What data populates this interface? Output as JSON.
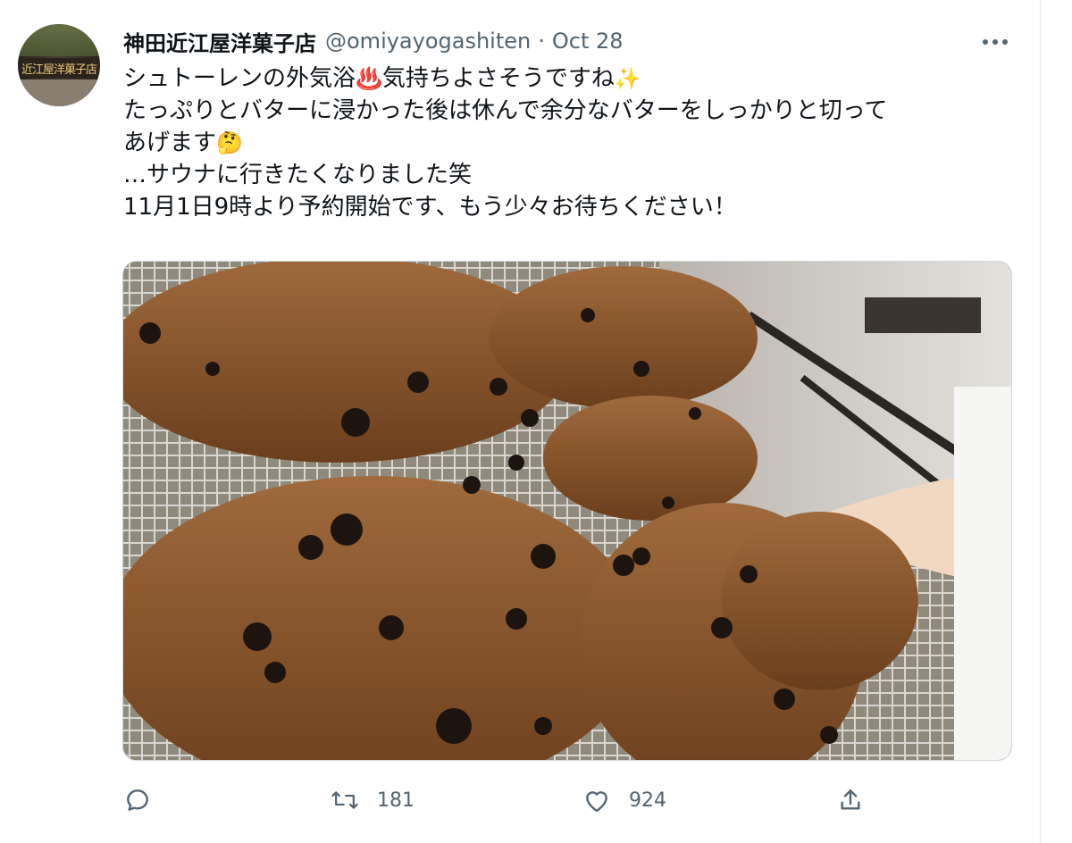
{
  "tweet": {
    "display_name": "神田近江屋洋菓子店",
    "handle": "@omiyayogashiten",
    "separator": "·",
    "date": "Oct 28",
    "avatar_sign_text": "近江屋洋菓子店",
    "lines": [
      {
        "text": "シュトーレンの外気浴",
        "emoji": "♨️",
        "after": "気持ちよさそうですね",
        "emoji2": "✨"
      },
      {
        "text": "たっぷりとバターに浸かった後は休んで余分なバターをしっかりと切って"
      },
      {
        "text": "あげます",
        "emoji": "🤔"
      },
      {
        "text": "…サウナに行きたくなりました笑"
      },
      {
        "text": "11月1日9時より予約開始です、もう少々お待ちください！"
      }
    ]
  },
  "actions": {
    "reply": {
      "icon": "reply-icon",
      "count": ""
    },
    "retweet": {
      "icon": "retweet-icon",
      "count": "181"
    },
    "like": {
      "icon": "heart-icon",
      "count": "924"
    },
    "share": {
      "icon": "share-icon",
      "count": ""
    }
  },
  "colors": {
    "text": "#0f1419",
    "secondary": "#536471",
    "border": "#cfd9de"
  }
}
